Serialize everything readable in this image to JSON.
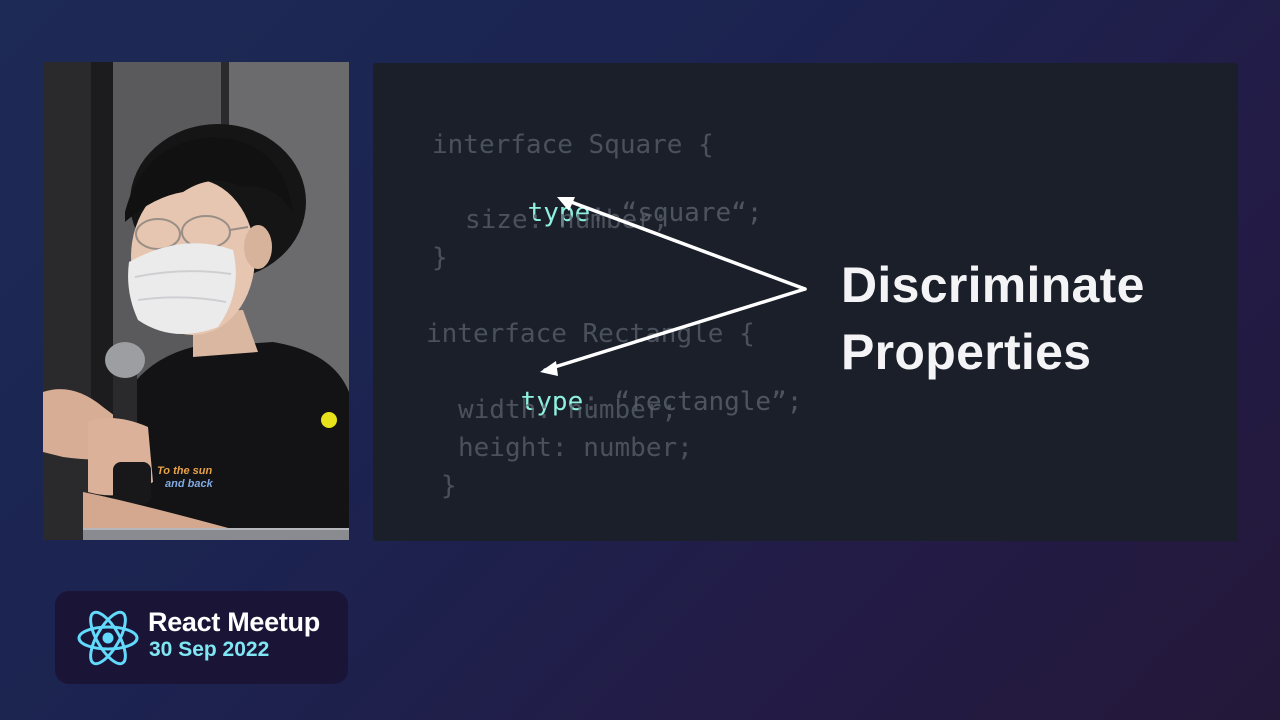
{
  "slide": {
    "code": {
      "square_open": "interface Square {",
      "square_type_key": "type",
      "square_type_rest": ": “square“;",
      "square_size": "size: number;",
      "square_close": "}",
      "rect_open": "interface Rectangle {",
      "rect_type_key": "type",
      "rect_type_rest": ": “rectangle”;",
      "rect_width": "width: number;",
      "rect_height": "height: number;",
      "rect_close": "}"
    },
    "heading": {
      "line1": "Discriminate",
      "line2": "Properties"
    }
  },
  "speaker": {
    "shirt_text_line1": "To the sun",
    "shirt_text_line2": "and back"
  },
  "badge": {
    "title": "React Meetup",
    "date": "30 Sep 2022"
  },
  "colors": {
    "code_keyword": "#8ff0e0",
    "code_dim": "#5c626d",
    "badge_date": "#7fe6f3",
    "react_logo": "#61dafb"
  }
}
